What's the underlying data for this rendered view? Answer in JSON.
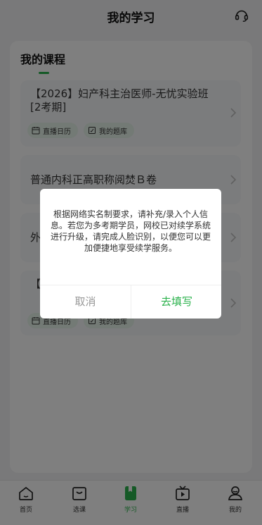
{
  "header": {
    "title": "我的学习",
    "support_icon": "headset-icon"
  },
  "card": {
    "title": "我的课程"
  },
  "courses": [
    {
      "name": "【2026】妇产科主治医师-无忧实验班[2考期]",
      "tags": [
        "直播日历",
        "我的题库"
      ]
    },
    {
      "name": "普通内科正高职称阅焚Ｂ卷",
      "tags": []
    },
    {
      "name": "外",
      "tags": []
    },
    {
      "name": "【2[2",
      "tags": [
        "直播日历",
        "我的题库"
      ]
    }
  ],
  "dialog": {
    "message": "根据网络实名制要求，请补充/录入个人信息。若您为多考期学员，网校已对续学系统进行升级，请完成人脸识别，以便您可以更加便捷地享受续学服务。",
    "cancel_label": "取消",
    "confirm_label": "去填写"
  },
  "tabbar": {
    "items": [
      {
        "label": "首页",
        "icon": "home-icon"
      },
      {
        "label": "选课",
        "icon": "course-select-icon"
      },
      {
        "label": "学习",
        "icon": "study-icon",
        "active": true
      },
      {
        "label": "直播",
        "icon": "live-tv-icon"
      },
      {
        "label": "我的",
        "icon": "profile-icon"
      }
    ]
  },
  "colors": {
    "accent": "#2bb24c",
    "background": "#f2f3f5",
    "overlay": "rgba(0,0,0,0.5)"
  }
}
